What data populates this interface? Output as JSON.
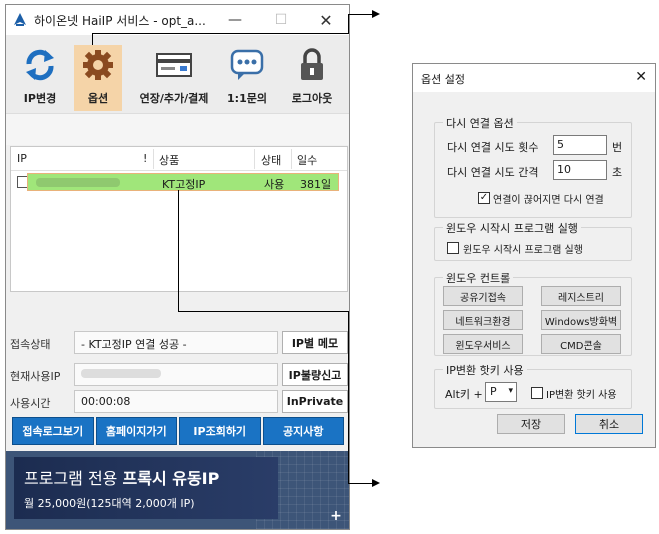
{
  "main_window": {
    "title": "하이온넷 HaiIP 서비스 - opt_a...",
    "toolbar": [
      {
        "label": "IP변경",
        "icon": "refresh-icon"
      },
      {
        "label": "옵션",
        "icon": "gear-icon"
      },
      {
        "label": "연장/추가/결제",
        "icon": "card-icon"
      },
      {
        "label": "1:1문의",
        "icon": "chat-icon"
      },
      {
        "label": "로그아웃",
        "icon": "lock-icon"
      }
    ],
    "table": {
      "headers": [
        "IP",
        "!",
        "상품",
        "상태",
        "일수"
      ],
      "row": {
        "product": "KT고정IP",
        "status": "사용",
        "days": "381일"
      }
    },
    "info": {
      "status_label": "접속상태",
      "status_value": "- KT고정IP 연결 성공 -",
      "current_ip_label": "현재사용IP",
      "time_label": "사용시간",
      "time_value": "00:00:08",
      "btn_memo": "IP별 메모",
      "btn_report": "IP불량신고",
      "btn_private": "InPrivate"
    },
    "actions": [
      "접속로그보기",
      "홈페이지가기",
      "IP조회하기",
      "공지사항"
    ],
    "banner": {
      "title_normal": "프로그램 전용 ",
      "title_bold": "프록시 유동IP",
      "subtitle": "월 25,000원(125대역 2,000개 IP)",
      "plus": "+"
    }
  },
  "dialog": {
    "title": "옵션 설정",
    "reconnect": {
      "group_title": "다시 연결 옵션",
      "retry_count_label": "다시 연결 시도 횟수",
      "retry_count_value": "5",
      "retry_count_unit": "번",
      "retry_interval_label": "다시 연결 시도 간격",
      "retry_interval_value": "10",
      "retry_interval_unit": "초",
      "auto_reconnect_label": "연결이 끊어지면 다시 연결",
      "auto_reconnect_checked": true
    },
    "startup": {
      "group_title": "윈도우 시작시 프로그램 실행",
      "checkbox_label": "윈도우 시작시 프로그램 실행",
      "checked": false
    },
    "windows_control": {
      "group_title": "윈도우 컨트롤",
      "buttons": [
        "공유기접속",
        "레지스트리",
        "네트워크환경",
        "Windows방화벽",
        "윈도우서비스",
        "CMD콘솔"
      ]
    },
    "hotkey": {
      "group_title": "IP변환 핫키 사용",
      "prefix": "Alt키 +",
      "key": "P",
      "checkbox_label": "IP변환 핫키 사용",
      "checked": false
    },
    "save": "저장",
    "cancel": "취소"
  },
  "colors": {
    "selected_row": "#a0e67a",
    "action_button": "#1a73c4",
    "option_highlight": "#f5d4a8"
  }
}
